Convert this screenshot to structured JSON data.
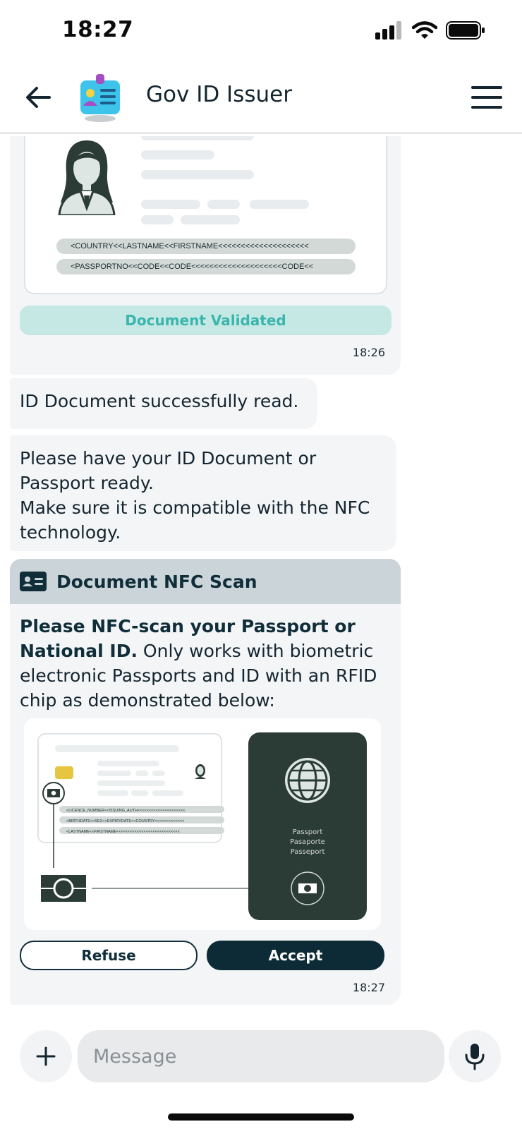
{
  "status_bar": {
    "time": "18:27"
  },
  "header": {
    "title": "Gov ID Issuer"
  },
  "messages": {
    "passport_card": {
      "mrz_line_1": "<COUNTRY<<LASTNAME<<FIRSTNAME<<<<<<<<<<<<<<<<<<<<",
      "mrz_line_2": "<PASSPORTNO<<CODE<<CODE<<<<<<<<<<<<<<<<<<<<CODE<<",
      "badge": "Document Validated",
      "time": "18:26"
    },
    "read_success": "ID Document successfully read.",
    "instructions": [
      "Please have your ID Document or",
      "Passport ready.",
      "Make sure it is compatible with the NFC",
      "technology."
    ],
    "nfc_card": {
      "title": "Document NFC Scan",
      "body_bold": "Please NFC-scan your Passport or National ID.",
      "body_rest": " Only works with biometric electronic Passports and ID with an RFID chip as demonstrated below:",
      "illustration": {
        "id_mrz_1": "<LICENCE_NUMBER<<ISSUING_AUTH<<<<<<<<<<<<<<<<<<<<<",
        "id_mrz_2": "<BIRTHDATE<<SEX<<EXPIRYDATE<<COUNTRY<<<<<<<<<<<<<",
        "id_mrz_3": "<LASTNAME<<FIRSTNAME<<<<<<<<<<<<<<<<<<<<<<<<<<<<",
        "passport_label_1": "Passport",
        "passport_label_2": "Pasaporte",
        "passport_label_3": "Passeport"
      },
      "refuse_label": "Refuse",
      "accept_label": "Accept",
      "time": "18:27"
    }
  },
  "composer": {
    "placeholder": "Message"
  },
  "colors": {
    "primary_dark": "#0d2b36",
    "badge_bg": "#c5e8e5",
    "badge_text": "#3bb6ad",
    "bubble_bg": "#f3f5f7",
    "passport_green": "#2b3b36"
  }
}
